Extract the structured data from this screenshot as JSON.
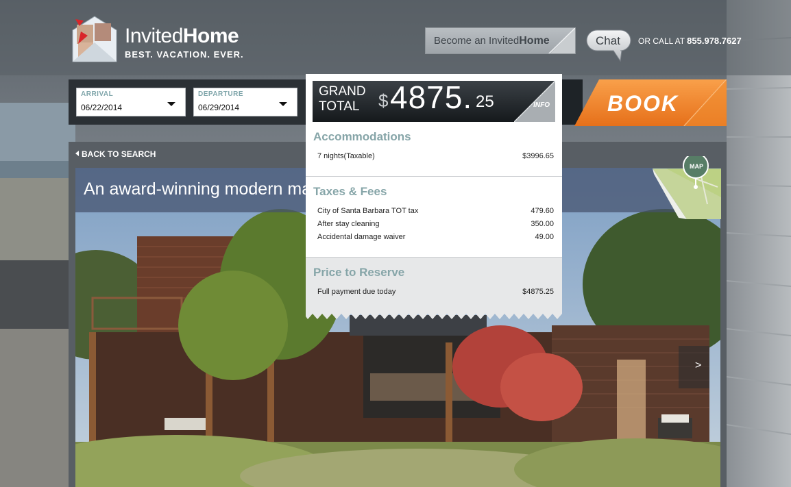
{
  "header": {
    "brand_light": "Invited",
    "brand_bold": "Home",
    "tagline": "BEST. VACATION. EVER.",
    "become_light": "Become an Invited",
    "become_bold": "Home",
    "chat_label": "Chat",
    "call_prefix": "OR CALL AT",
    "call_number": "855.978.7627"
  },
  "booking": {
    "arrival_label": "ARRIVAL",
    "arrival_value": "06/22/2014",
    "departure_label": "DEPARTURE",
    "departure_value": "06/29/2014",
    "book_label": "BOOK"
  },
  "listing": {
    "back_label": "BACK TO SEARCH",
    "title": "An award-winning modern masterpiece",
    "map_label": "MAP",
    "next_label": ">"
  },
  "receipt": {
    "grand_line1": "GRAND",
    "grand_line2": "TOTAL",
    "currency": "$",
    "amount_whole": "4875.",
    "amount_cents": "25",
    "info_label": "INFO",
    "sections": {
      "accommodations": {
        "title": "Accommodations",
        "items": [
          {
            "label": "7 nights(Taxable)",
            "amount": "$3996.65"
          }
        ]
      },
      "taxes": {
        "title": "Taxes & Fees",
        "items": [
          {
            "label": "City of Santa Barbara TOT tax",
            "amount": "479.60"
          },
          {
            "label": "After stay cleaning",
            "amount": "350.00"
          },
          {
            "label": "Accidental damage waiver",
            "amount": "49.00"
          }
        ]
      },
      "reserve": {
        "title": "Price to Reserve",
        "items": [
          {
            "label": "Full payment due today",
            "amount": "$4875.25"
          }
        ]
      }
    }
  },
  "colors": {
    "accent_teal": "#86a5a8",
    "book_orange": "#f07d1a",
    "dark_bar": "#2b3035"
  }
}
